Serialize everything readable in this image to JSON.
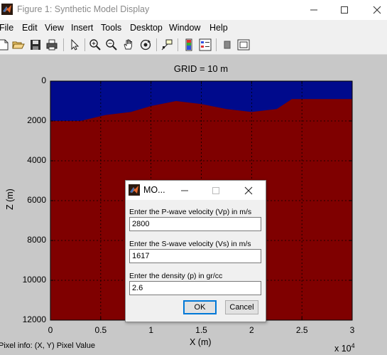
{
  "window": {
    "title": "Figure 1: Synthetic Model Display"
  },
  "menu": {
    "items": [
      "File",
      "Edit",
      "View",
      "Insert",
      "Tools",
      "Desktop",
      "Window",
      "Help"
    ]
  },
  "toolbar": {
    "icons": [
      "new-figure-icon",
      "open-file-icon",
      "save-icon",
      "print-icon",
      "edit-plot-arrow-icon",
      "zoom-in-icon",
      "zoom-out-icon",
      "pan-hand-icon",
      "rotate-3d-icon",
      "data-cursor-icon",
      "insert-colorbar-icon",
      "insert-legend-icon",
      "hide-plot-tools-icon",
      "show-plot-tools-icon"
    ]
  },
  "colors": {
    "water": "#000a8c",
    "earth": "#7f0000",
    "figure_bg": "#c8c8c8",
    "matlab_orange": "#e8692d"
  },
  "chart_data": {
    "type": "heatmap",
    "title": "GRID = 10 m",
    "xlabel": "X (m)",
    "ylabel": "Z (m)",
    "x_ticks": [
      "0",
      "0.5",
      "1",
      "1.5",
      "2",
      "2.5",
      "3"
    ],
    "x_exponent_label": "x 10",
    "x_exponent_power": "4",
    "y_ticks": [
      "0",
      "2000",
      "4000",
      "6000",
      "8000",
      "10000",
      "12000"
    ],
    "xlim": [
      0,
      30000
    ],
    "ylim": [
      0,
      12000
    ],
    "y_reversed": true,
    "grid": true,
    "layers": [
      {
        "name": "upper layer",
        "color": "#000a8c"
      },
      {
        "name": "lower layer",
        "color": "#7f0000"
      }
    ],
    "interface": {
      "x": [
        0,
        3000,
        5500,
        8000,
        10000,
        12500,
        15000,
        17500,
        20000,
        22500,
        24000,
        24700,
        26000,
        30000
      ],
      "z": [
        2000,
        2000,
        1700,
        1550,
        1250,
        1000,
        1150,
        1400,
        1550,
        1400,
        900,
        900,
        900,
        900
      ]
    }
  },
  "status": {
    "pixel_info": "Pixel info: (X, Y)  Pixel Value"
  },
  "dialog": {
    "title": "MO...",
    "vp_label": "Enter the P-wave velocity (Vp) in m/s",
    "vp_value": "2800",
    "vs_label": "Enter the S-wave velocity (Vs) in m/s",
    "vs_value": "1617",
    "density_label": "Enter the density (p) in gr/cc",
    "density_value": "2.6",
    "ok_label": "OK",
    "cancel_label": "Cancel"
  }
}
